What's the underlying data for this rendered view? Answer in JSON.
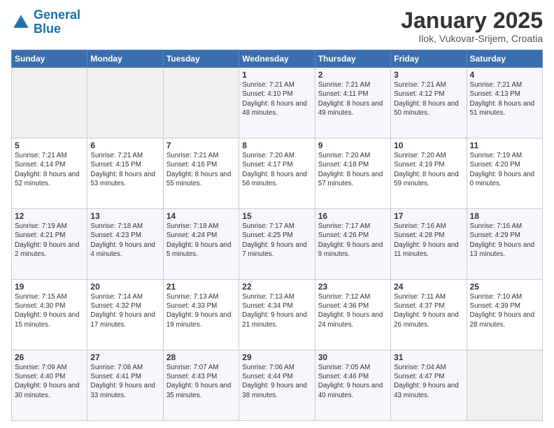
{
  "logo": {
    "line1": "General",
    "line2": "Blue"
  },
  "header": {
    "title": "January 2025",
    "subtitle": "Ilok, Vukovar-Srijem, Croatia"
  },
  "weekdays": [
    "Sunday",
    "Monday",
    "Tuesday",
    "Wednesday",
    "Thursday",
    "Friday",
    "Saturday"
  ],
  "weeks": [
    [
      {
        "day": "",
        "info": ""
      },
      {
        "day": "",
        "info": ""
      },
      {
        "day": "",
        "info": ""
      },
      {
        "day": "1",
        "info": "Sunrise: 7:21 AM\nSunset: 4:10 PM\nDaylight: 8 hours\nand 48 minutes."
      },
      {
        "day": "2",
        "info": "Sunrise: 7:21 AM\nSunset: 4:11 PM\nDaylight: 8 hours\nand 49 minutes."
      },
      {
        "day": "3",
        "info": "Sunrise: 7:21 AM\nSunset: 4:12 PM\nDaylight: 8 hours\nand 50 minutes."
      },
      {
        "day": "4",
        "info": "Sunrise: 7:21 AM\nSunset: 4:13 PM\nDaylight: 8 hours\nand 51 minutes."
      }
    ],
    [
      {
        "day": "5",
        "info": "Sunrise: 7:21 AM\nSunset: 4:14 PM\nDaylight: 8 hours\nand 52 minutes."
      },
      {
        "day": "6",
        "info": "Sunrise: 7:21 AM\nSunset: 4:15 PM\nDaylight: 8 hours\nand 53 minutes."
      },
      {
        "day": "7",
        "info": "Sunrise: 7:21 AM\nSunset: 4:16 PM\nDaylight: 8 hours\nand 55 minutes."
      },
      {
        "day": "8",
        "info": "Sunrise: 7:20 AM\nSunset: 4:17 PM\nDaylight: 8 hours\nand 56 minutes."
      },
      {
        "day": "9",
        "info": "Sunrise: 7:20 AM\nSunset: 4:18 PM\nDaylight: 8 hours\nand 57 minutes."
      },
      {
        "day": "10",
        "info": "Sunrise: 7:20 AM\nSunset: 4:19 PM\nDaylight: 8 hours\nand 59 minutes."
      },
      {
        "day": "11",
        "info": "Sunrise: 7:19 AM\nSunset: 4:20 PM\nDaylight: 9 hours\nand 0 minutes."
      }
    ],
    [
      {
        "day": "12",
        "info": "Sunrise: 7:19 AM\nSunset: 4:21 PM\nDaylight: 9 hours\nand 2 minutes."
      },
      {
        "day": "13",
        "info": "Sunrise: 7:18 AM\nSunset: 4:23 PM\nDaylight: 9 hours\nand 4 minutes."
      },
      {
        "day": "14",
        "info": "Sunrise: 7:18 AM\nSunset: 4:24 PM\nDaylight: 9 hours\nand 5 minutes."
      },
      {
        "day": "15",
        "info": "Sunrise: 7:17 AM\nSunset: 4:25 PM\nDaylight: 9 hours\nand 7 minutes."
      },
      {
        "day": "16",
        "info": "Sunrise: 7:17 AM\nSunset: 4:26 PM\nDaylight: 9 hours\nand 9 minutes."
      },
      {
        "day": "17",
        "info": "Sunrise: 7:16 AM\nSunset: 4:28 PM\nDaylight: 9 hours\nand 11 minutes."
      },
      {
        "day": "18",
        "info": "Sunrise: 7:16 AM\nSunset: 4:29 PM\nDaylight: 9 hours\nand 13 minutes."
      }
    ],
    [
      {
        "day": "19",
        "info": "Sunrise: 7:15 AM\nSunset: 4:30 PM\nDaylight: 9 hours\nand 15 minutes."
      },
      {
        "day": "20",
        "info": "Sunrise: 7:14 AM\nSunset: 4:32 PM\nDaylight: 9 hours\nand 17 minutes."
      },
      {
        "day": "21",
        "info": "Sunrise: 7:13 AM\nSunset: 4:33 PM\nDaylight: 9 hours\nand 19 minutes."
      },
      {
        "day": "22",
        "info": "Sunrise: 7:13 AM\nSunset: 4:34 PM\nDaylight: 9 hours\nand 21 minutes."
      },
      {
        "day": "23",
        "info": "Sunrise: 7:12 AM\nSunset: 4:36 PM\nDaylight: 9 hours\nand 24 minutes."
      },
      {
        "day": "24",
        "info": "Sunrise: 7:11 AM\nSunset: 4:37 PM\nDaylight: 9 hours\nand 26 minutes."
      },
      {
        "day": "25",
        "info": "Sunrise: 7:10 AM\nSunset: 4:39 PM\nDaylight: 9 hours\nand 28 minutes."
      }
    ],
    [
      {
        "day": "26",
        "info": "Sunrise: 7:09 AM\nSunset: 4:40 PM\nDaylight: 9 hours\nand 30 minutes."
      },
      {
        "day": "27",
        "info": "Sunrise: 7:08 AM\nSunset: 4:41 PM\nDaylight: 9 hours\nand 33 minutes."
      },
      {
        "day": "28",
        "info": "Sunrise: 7:07 AM\nSunset: 4:43 PM\nDaylight: 9 hours\nand 35 minutes."
      },
      {
        "day": "29",
        "info": "Sunrise: 7:06 AM\nSunset: 4:44 PM\nDaylight: 9 hours\nand 38 minutes."
      },
      {
        "day": "30",
        "info": "Sunrise: 7:05 AM\nSunset: 4:46 PM\nDaylight: 9 hours\nand 40 minutes."
      },
      {
        "day": "31",
        "info": "Sunrise: 7:04 AM\nSunset: 4:47 PM\nDaylight: 9 hours\nand 43 minutes."
      },
      {
        "day": "",
        "info": ""
      }
    ]
  ]
}
